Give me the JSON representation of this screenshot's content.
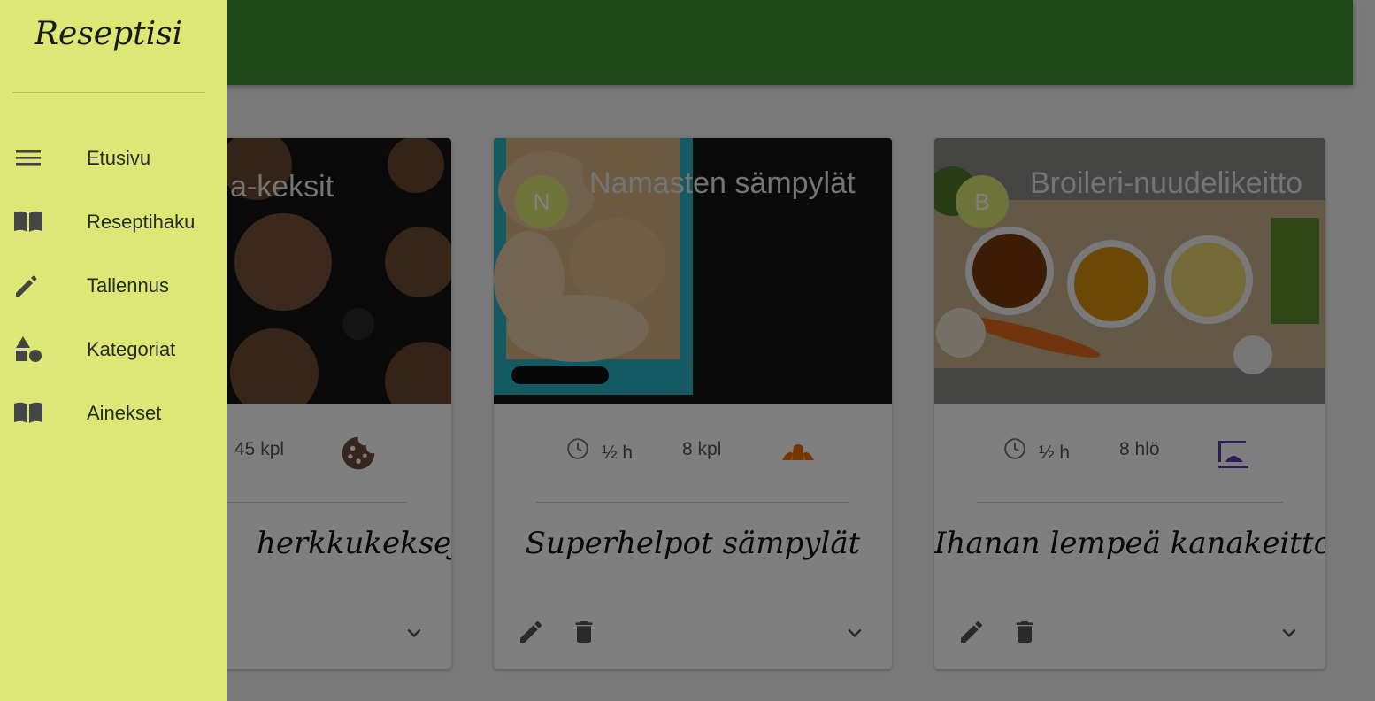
{
  "app": {
    "name": "Reseptisi"
  },
  "drawer": {
    "items": [
      {
        "label": "Etusivu",
        "icon": "menu-icon"
      },
      {
        "label": "Reseptihaku",
        "icon": "book-open-icon"
      },
      {
        "label": "Tallennus",
        "icon": "pencil-icon"
      },
      {
        "label": "Kategoriat",
        "icon": "shapes-icon"
      },
      {
        "label": "Ainekset",
        "icon": "book-open-icon"
      }
    ]
  },
  "cards": [
    {
      "title": "a-keksit",
      "quantity": "45 kpl",
      "description": "herkkukeksejä!",
      "icon": "cookie-icon"
    },
    {
      "avatar": "N",
      "title": "Namasten sämpylät",
      "time": "½ h",
      "quantity": "8 kpl",
      "description": "Superhelpot sämpylät",
      "icon": "croissant-icon"
    },
    {
      "avatar": "B",
      "title": "Broileri-nuudelikeitto",
      "time": "½ h",
      "quantity": "8 hlö",
      "description": "Ihanan lempeä kanakeitto.",
      "icon": "serving-dish-icon"
    }
  ],
  "colors": {
    "appbar": "#3e8e34",
    "drawer": "#dce775",
    "avatar": "#dce775",
    "cookie_icon": "#6d4c41",
    "croissant_icon": "#ef6c00",
    "dish_icon": "#5e35b1"
  }
}
